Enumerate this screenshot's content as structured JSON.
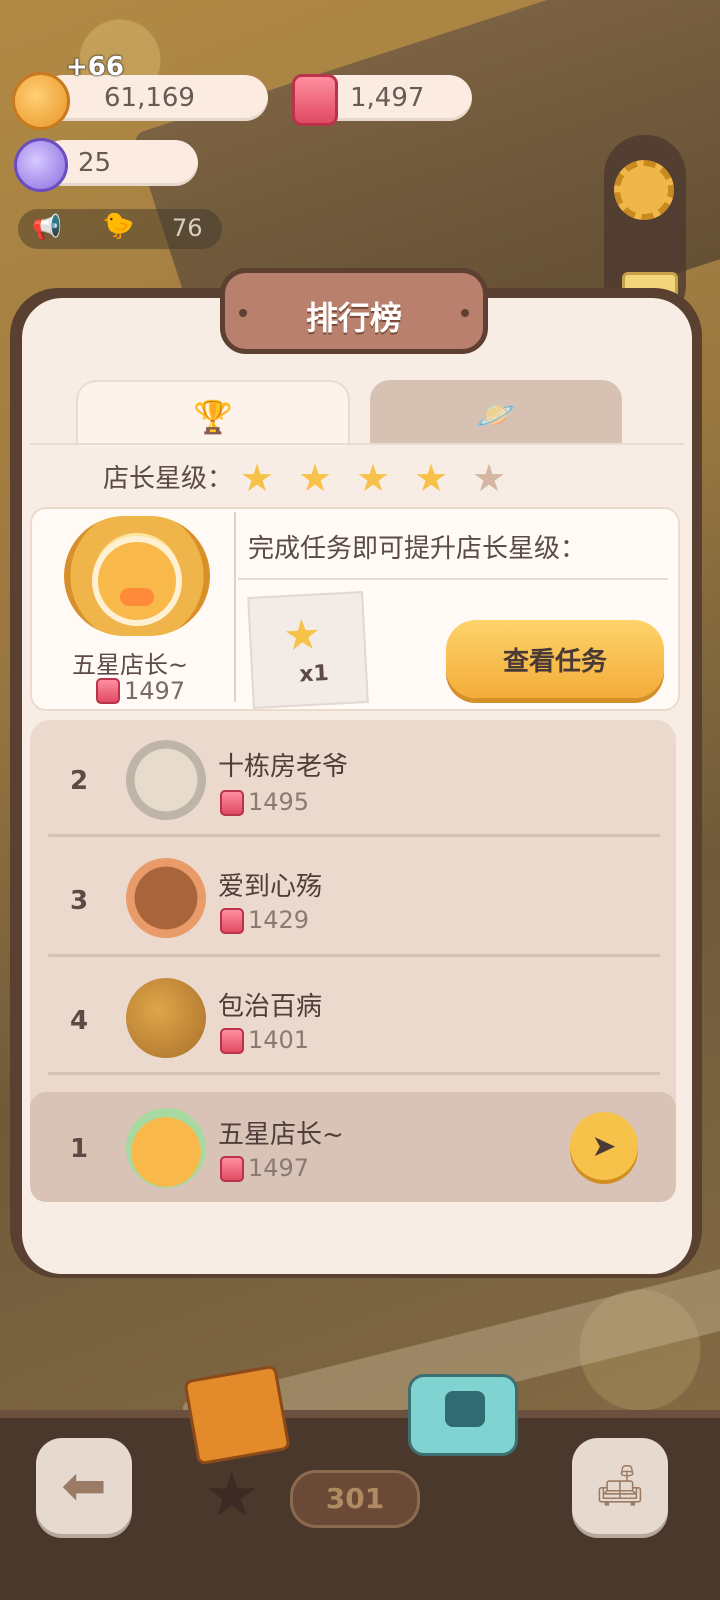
{
  "resources": {
    "cookie_value": "61,169",
    "cookie_plus": "+66",
    "jam_value": "1,497",
    "candy_value": "25",
    "ad_value": "76"
  },
  "panel": {
    "title": "排行榜",
    "tabs": [
      {
        "icon": "trophy-icon",
        "glyph": "🏆",
        "active": true
      },
      {
        "icon": "planet-icon",
        "glyph": "🪐",
        "active": false
      }
    ],
    "star_label": "店长星级：",
    "stars": {
      "filled": 4,
      "total": 5
    },
    "player": {
      "name": "五星店长~",
      "score": "1497"
    },
    "task": {
      "text": "完成任务即可提升店长星级：",
      "reward_count": "x1",
      "button": "查看任务"
    }
  },
  "leaderboard": [
    {
      "rank": "2",
      "name": "十栋房老爷",
      "score": "1495"
    },
    {
      "rank": "3",
      "name": "爱到心殇",
      "score": "1429"
    },
    {
      "rank": "4",
      "name": "包治百病",
      "score": "1401"
    }
  ],
  "me": {
    "rank": "1",
    "name": "五星店长~",
    "score": "1497"
  },
  "bottom": {
    "count": "301"
  }
}
